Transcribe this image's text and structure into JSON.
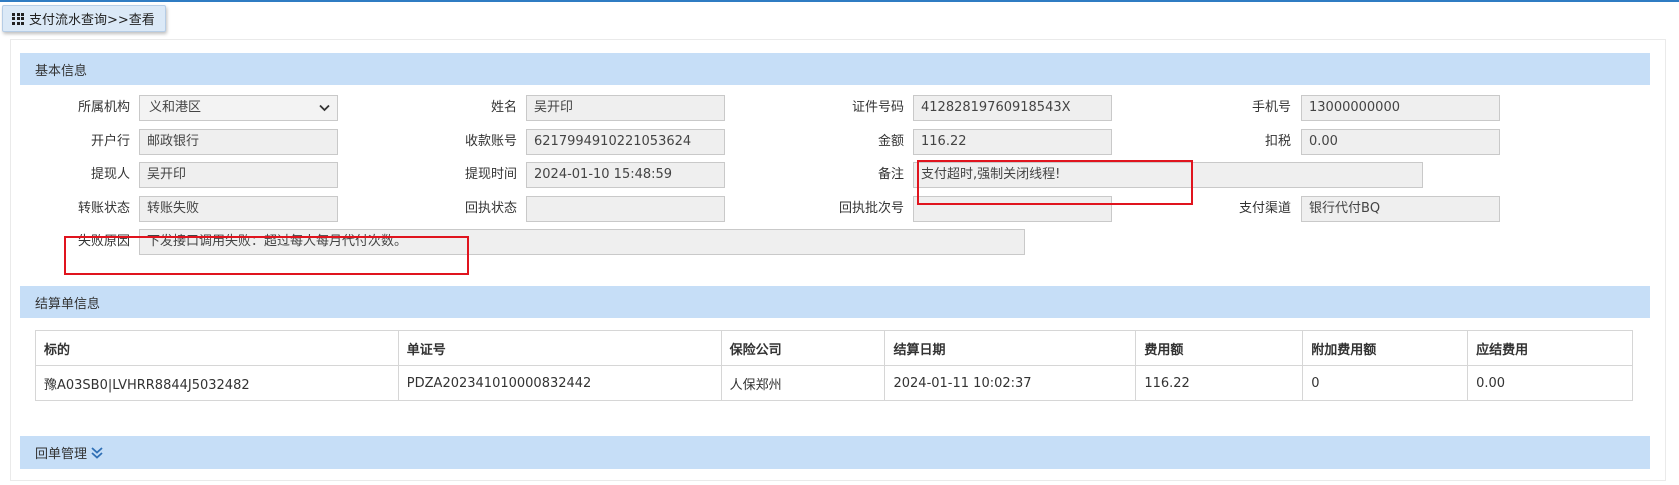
{
  "breadcrumb": {
    "icon": "grid-menu-icon",
    "text": "支付流水查询>>查看"
  },
  "basic_info": {
    "title": "基本信息",
    "fields": {
      "institution": {
        "label": "所属机构",
        "value": "义和港区"
      },
      "name": {
        "label": "姓名",
        "value": "吴开印"
      },
      "id_number": {
        "label": "证件号码",
        "value": "41282819760918543X"
      },
      "phone": {
        "label": "手机号",
        "value": "13000000000"
      },
      "bank": {
        "label": "开户行",
        "value": "邮政银行"
      },
      "account": {
        "label": "收款账号",
        "value": "6217994910221053624"
      },
      "amount": {
        "label": "金额",
        "value": "116.22"
      },
      "tax": {
        "label": "扣税",
        "value": "0.00"
      },
      "withdrawer": {
        "label": "提现人",
        "value": "吴开印"
      },
      "withdraw_time": {
        "label": "提现时间",
        "value": "2024-01-10 15:48:59"
      },
      "remark": {
        "label": "备注",
        "value": "支付超时,强制关闭线程!"
      },
      "transfer_status": {
        "label": "转账状态",
        "value": "转账失败"
      },
      "receipt_status": {
        "label": "回执状态",
        "value": ""
      },
      "receipt_batch": {
        "label": "回执批次号",
        "value": ""
      },
      "pay_channel": {
        "label": "支付渠道",
        "value": "银行代付BQ"
      },
      "fail_reason": {
        "label": "失败原因",
        "value": "下发接口调用失败：超过每人每月代付次数。"
      }
    }
  },
  "settlement": {
    "title": "结算单信息",
    "columns": [
      "标的",
      "单证号",
      "保险公司",
      "结算日期",
      "费用额",
      "附加费用额",
      "应结费用"
    ],
    "rows": [
      [
        "豫A03SB0|LVHRR8844J5032482",
        "PDZA202341010000832442",
        "人保郑州",
        "2024-01-11 10:02:37",
        "116.22",
        "0",
        "0.00"
      ]
    ]
  },
  "receipt_mgmt": {
    "title": "回单管理",
    "icon": "double-chevron-down-icon"
  },
  "colors": {
    "section_bg": "#c6def7",
    "highlight_border": "#e0141e",
    "top_bar": "#2f7cc3"
  }
}
